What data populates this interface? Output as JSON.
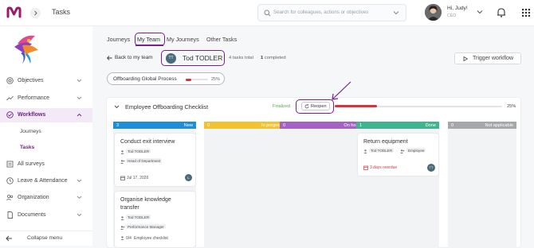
{
  "header": {
    "page_title": "Tasks",
    "search_placeholder": "Search for colleagues, actions or objectives",
    "user_greeting": "Hi, Judy!",
    "user_role": "CEO"
  },
  "sidebar": {
    "items": [
      {
        "label": "Objectives",
        "icon": "target-icon"
      },
      {
        "label": "Performance",
        "icon": "trend-icon"
      },
      {
        "label": "Workflows",
        "icon": "check-circle-icon"
      },
      {
        "label": "All surveys",
        "icon": "survey-icon"
      },
      {
        "label": "Leave & Attendance",
        "icon": "clock-icon"
      },
      {
        "label": "Organization",
        "icon": "people-icon"
      },
      {
        "label": "Documents",
        "icon": "document-icon"
      }
    ],
    "workflow_sub": [
      "Journeys",
      "Tasks"
    ],
    "collapse_label": "Collapse menu"
  },
  "tabs": [
    "Journeys",
    "My Team",
    "My Journeys",
    "Other Tasks"
  ],
  "back_label": "Back to my team",
  "employee": {
    "initials": "TT",
    "name": "Tod TODLER"
  },
  "tasks_total": "4 tasks total",
  "tasks_completed_count": "1",
  "tasks_completed_label": "completed",
  "trigger_label": "Trigger workflow",
  "process": {
    "label": "Offboarding Global Process",
    "progress": 25,
    "progress_label": "25%"
  },
  "checklist": {
    "title": "Employee Offboarding Checklist",
    "status": "Finalized",
    "reopen_label": "Reopen",
    "progress": 25,
    "progress_label": "25%"
  },
  "columns": [
    {
      "count": "3",
      "title": "New",
      "color": "#1f8ed6"
    },
    {
      "count": "0",
      "title": "In progress",
      "color": "#f2c232"
    },
    {
      "count": "0",
      "title": "On hold",
      "color": "#a463c4"
    },
    {
      "count": "1",
      "title": "Done",
      "color": "#3fb48e"
    },
    {
      "count": "0",
      "title": "Not applicable",
      "color": "#a5a7ab"
    }
  ],
  "tasks": {
    "t1": {
      "title": "Conduct exit interview",
      "assignee": "Tod TODLER",
      "role": "Head of Department",
      "date": "Jul 17, 2026",
      "avatar": "L"
    },
    "t2": {
      "title_line1": "Organise knowledge",
      "title_line2": "transfer",
      "assignee": "Tod TODLER",
      "role": "Performance Manager",
      "checklist": "0/4",
      "checklist_label": "Employee checklist"
    },
    "t3": {
      "title": "Return equipment",
      "assignee": "Tod TODLER",
      "role": "Employee",
      "overdue": "3 days overdue",
      "avatar": "TT"
    }
  },
  "colors": {
    "accent": "#7b1e90",
    "danger": "#d6343b",
    "success": "#5aa84a"
  }
}
